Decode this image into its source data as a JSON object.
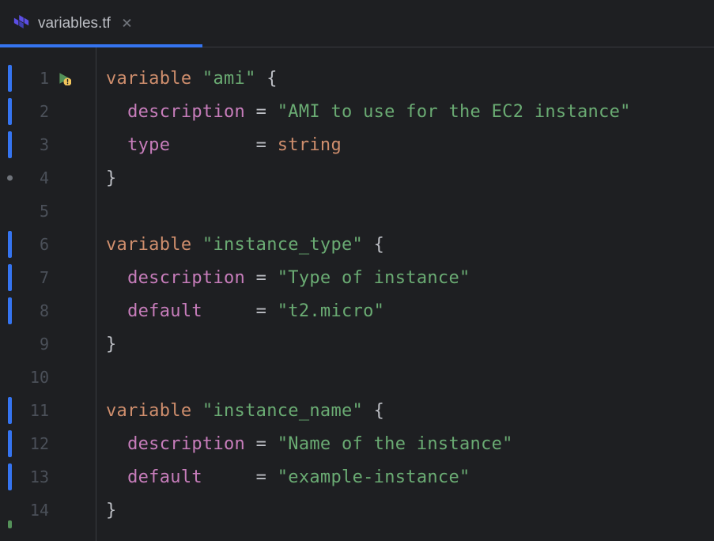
{
  "tab": {
    "filename": "variables.tf",
    "close_glyph": "×"
  },
  "lines": {
    "l1_kw": "variable",
    "l1_name": "\"ami\"",
    "l1_brace": " {",
    "l2_prop": "description",
    "l2_val": "\"AMI to use for the EC2 instance\"",
    "l3_prop": "type",
    "l3_val": "string",
    "l4": "}",
    "l6_kw": "variable",
    "l6_name": "\"instance_type\"",
    "l6_brace": " {",
    "l7_prop": "description",
    "l7_val": "\"Type of instance\"",
    "l8_prop": "default",
    "l8_val": "\"t2.micro\"",
    "l9": "}",
    "l11_kw": "variable",
    "l11_name": "\"instance_name\"",
    "l11_brace": " {",
    "l12_prop": "description",
    "l12_val": "\"Name of the instance\"",
    "l13_prop": "default",
    "l13_val": "\"example-instance\"",
    "l14": "}"
  },
  "line_numbers": [
    "1",
    "2",
    "3",
    "4",
    "5",
    "6",
    "7",
    "8",
    "9",
    "10",
    "11",
    "12",
    "13",
    "14"
  ]
}
